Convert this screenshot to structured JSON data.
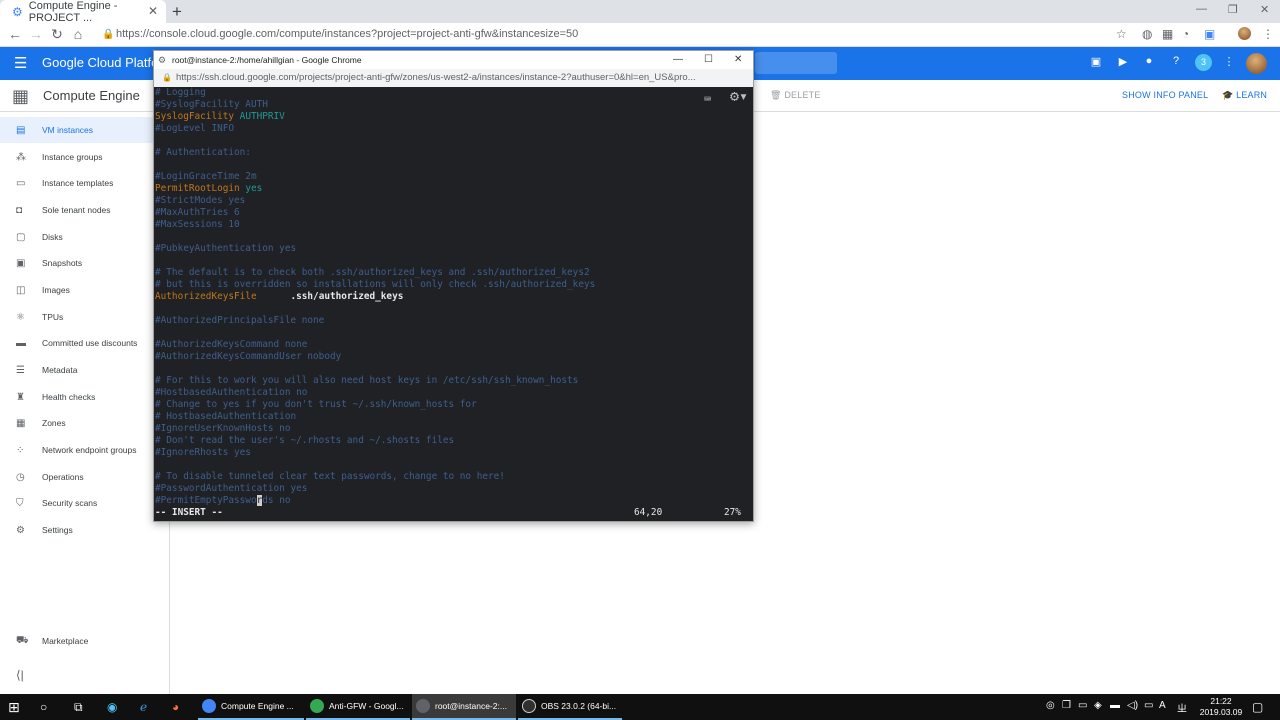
{
  "browser": {
    "tab_title": "Compute Engine - PROJECT ...",
    "new_tab": "+",
    "url": "https://console.cloud.google.com/compute/instances?project=project-anti-gfw&instancesize=50"
  },
  "appbar": {
    "title": "Google Cloud Platform",
    "notification_count": "3"
  },
  "header": {
    "product": "Compute Engine",
    "delete_label": "DELETE",
    "info_panel_label": "SHOW INFO PANEL",
    "learn_label": "LEARN"
  },
  "sidebar": {
    "items": [
      {
        "label": "VM instances",
        "icon": "vm-icon"
      },
      {
        "label": "Instance groups",
        "icon": "groups-icon"
      },
      {
        "label": "Instance templates",
        "icon": "template-icon"
      },
      {
        "label": "Sole tenant nodes",
        "icon": "node-icon"
      },
      {
        "label": "Disks",
        "icon": "disk-icon"
      },
      {
        "label": "Snapshots",
        "icon": "snapshot-icon"
      },
      {
        "label": "Images",
        "icon": "image-icon"
      },
      {
        "label": "TPUs",
        "icon": "tpu-icon"
      },
      {
        "label": "Committed use discounts",
        "icon": "discount-icon"
      },
      {
        "label": "Metadata",
        "icon": "metadata-icon"
      },
      {
        "label": "Health checks",
        "icon": "health-icon"
      },
      {
        "label": "Zones",
        "icon": "zone-icon"
      },
      {
        "label": "Network endpoint groups",
        "icon": "network-icon"
      },
      {
        "label": "Operations",
        "icon": "clock-icon"
      },
      {
        "label": "Security scans",
        "icon": "shield-icon"
      },
      {
        "label": "Settings",
        "icon": "gear-icon"
      }
    ],
    "marketplace": "Marketplace"
  },
  "ssh_window": {
    "title": "root@instance-2:/home/ahillgian - Google Chrome",
    "url": "https://ssh.cloud.google.com/projects/project-anti-gfw/zones/us-west2-a/instances/instance-2?authuser=0&hl=en_US&pro..."
  },
  "terminal": {
    "lines": [
      [
        {
          "t": "# Logging",
          "c": "cm"
        }
      ],
      [
        {
          "t": "#SyslogFacility AUTH",
          "c": "cm"
        }
      ],
      [
        {
          "t": "SyslogFacility ",
          "c": "kw"
        },
        {
          "t": "AUTHPRIV",
          "c": "vl"
        }
      ],
      [
        {
          "t": "#LogLevel INFO",
          "c": "cm"
        }
      ],
      [],
      [
        {
          "t": "# Authentication:",
          "c": "cm"
        }
      ],
      [],
      [
        {
          "t": "#LoginGraceTime 2m",
          "c": "cm"
        }
      ],
      [
        {
          "t": "PermitRootLogin ",
          "c": "kw"
        },
        {
          "t": "yes",
          "c": "vl"
        }
      ],
      [
        {
          "t": "#StrictModes yes",
          "c": "cm"
        }
      ],
      [
        {
          "t": "#MaxAuthTries 6",
          "c": "cm"
        }
      ],
      [
        {
          "t": "#MaxSessions 10",
          "c": "cm"
        }
      ],
      [],
      [
        {
          "t": "#PubkeyAuthentication yes",
          "c": "cm"
        }
      ],
      [],
      [
        {
          "t": "# The default is to check both .ssh/authorized_keys and .ssh/authorized_keys2",
          "c": "cm"
        }
      ],
      [
        {
          "t": "# but this is overridden so installations will only check .ssh/authorized_keys",
          "c": "cm"
        }
      ],
      [
        {
          "t": "AuthorizedKeysFile",
          "c": "kw"
        },
        {
          "t": "      .ssh/authorized_keys",
          "c": "bd"
        }
      ],
      [],
      [
        {
          "t": "#AuthorizedPrincipalsFile none",
          "c": "cm"
        }
      ],
      [],
      [
        {
          "t": "#AuthorizedKeysCommand none",
          "c": "cm"
        }
      ],
      [
        {
          "t": "#AuthorizedKeysCommandUser nobody",
          "c": "cm"
        }
      ],
      [],
      [
        {
          "t": "# For this to work you will also need host keys in /etc/ssh/ssh_known_hosts",
          "c": "cm"
        }
      ],
      [
        {
          "t": "#HostbasedAuthentication no",
          "c": "cm"
        }
      ],
      [
        {
          "t": "# Change to yes if you don't trust ~/.ssh/known_hosts for",
          "c": "cm"
        }
      ],
      [
        {
          "t": "# HostbasedAuthentication",
          "c": "cm"
        }
      ],
      [
        {
          "t": "#IgnoreUserKnownHosts no",
          "c": "cm"
        }
      ],
      [
        {
          "t": "# Don't read the user's ~/.rhosts and ~/.shosts files",
          "c": "cm"
        }
      ],
      [
        {
          "t": "#IgnoreRhosts yes",
          "c": "cm"
        }
      ],
      [],
      [
        {
          "t": "# To disable tunneled clear text passwords, change to no here!",
          "c": "cm"
        }
      ],
      [
        {
          "t": "#PasswordAuthentication yes",
          "c": "cm"
        }
      ],
      [
        {
          "t": "#PermitEmptyPasswo",
          "c": "cm"
        },
        {
          "t": "r",
          "c": "cursor"
        },
        {
          "t": "ds no",
          "c": "cm"
        }
      ]
    ],
    "status_mode": "-- INSERT --",
    "status_position": "64,20",
    "status_percent": "27%"
  },
  "taskbar": {
    "items": [
      {
        "label": "Compute Engine ...",
        "color": "#4285f4"
      },
      {
        "label": "Anti-GFW - Googl...",
        "color": "#34a853"
      },
      {
        "label": "root@instance-2:...",
        "color": "#5f6368"
      },
      {
        "label": "OBS 23.0.2 (64-bi...",
        "color": "#303030"
      }
    ],
    "ime": "A",
    "ime2": "ㄓ",
    "time": "21:22",
    "date": "2019.03.09"
  }
}
